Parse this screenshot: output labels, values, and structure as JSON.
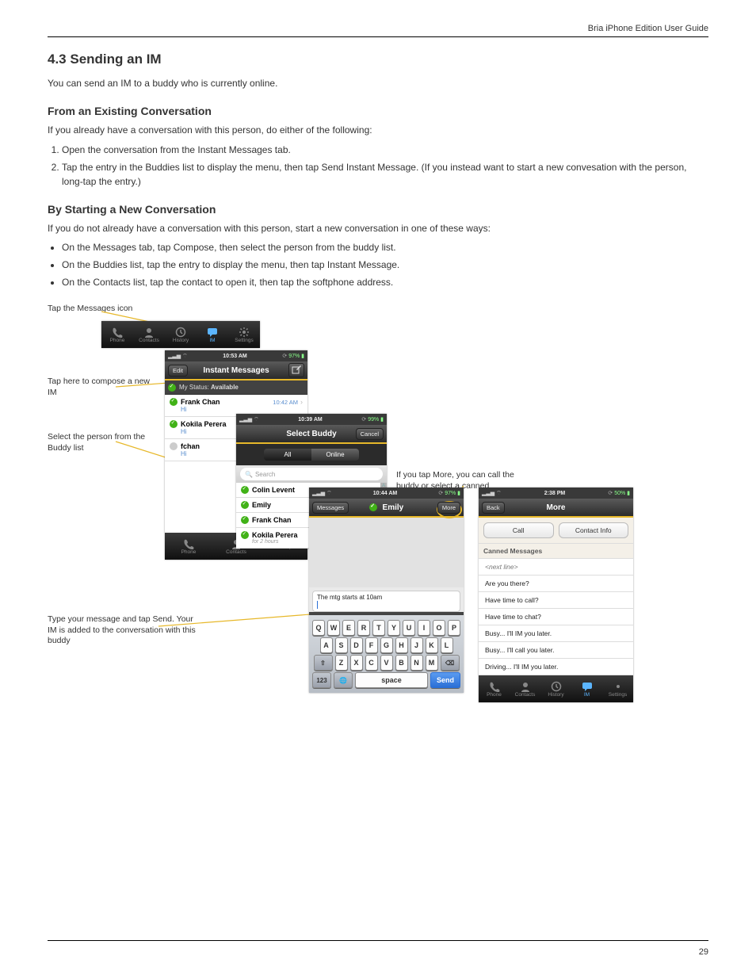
{
  "header": {
    "doc_title": "Bria iPhone Edition User Guide"
  },
  "footer": {
    "page": "29"
  },
  "section": {
    "heading": "4.3 Sending an IM",
    "para1": "You can send an IM to a buddy who is currently online.",
    "method1_title": "From an Existing Conversation",
    "method1_text": "If you already have a conversation with this person, do either of the following:",
    "steps": [
      "Open the conversation from the Instant Messages tab.",
      "Tap the entry in the Buddies list to display the menu, then tap Send Instant Message. (If you instead want to start a new convesation with the person, long-tap the entry.)"
    ],
    "method2_title": "By Starting a New Conversation",
    "method2_text": "If you do not already have a conversation with this person, start a new conversation in one of these ways:",
    "bullets": [
      "On the Messages tab, tap Compose, then select the person from the buddy list.",
      "On the Buddies list, tap the entry to display the menu, then tap Instant Message.",
      "On the Contacts list, tap the contact to open it, then tap the softphone address."
    ]
  },
  "callouts": {
    "c1": "Tap the Messages icon",
    "c2": "Tap here to compose a new IM",
    "c3": "Select the person from the Buddy list",
    "c4": "Type your message and tap Send. Your IM is added to the conversation with this buddy",
    "c5": "If you tap More, you can call the buddy or select a canned message"
  },
  "tabbar": {
    "items": [
      {
        "label": "Phone"
      },
      {
        "label": "Contacts"
      },
      {
        "label": "History"
      },
      {
        "label": "IM"
      },
      {
        "label": "Settings"
      }
    ]
  },
  "phoneA": {
    "time": "10:53 AM",
    "battery": "97%",
    "edit": "Edit",
    "title": "Instant Messages",
    "status_label": "My Status:",
    "status_value": "Available",
    "rows": [
      {
        "name": "Frank Chan",
        "msg": "Hi",
        "time": "10:42 AM",
        "dot": "green"
      },
      {
        "name": "Kokila Perera",
        "msg": "Hi",
        "time": "",
        "dot": "green"
      },
      {
        "name": "fchan",
        "msg": "Hi",
        "time": "",
        "dot": "gray"
      }
    ]
  },
  "phoneB": {
    "time": "10:39 AM",
    "battery": "99%",
    "title": "Select Buddy",
    "cancel": "Cancel",
    "seg_all": "All",
    "seg_online": "Online",
    "search": "Search",
    "rows": [
      {
        "name_bold": "Colin",
        "name": "Levent",
        "dot": "green"
      },
      {
        "name_bold": "Emily",
        "name": "",
        "dot": "green"
      },
      {
        "name_bold": "Frank",
        "name": "Chan",
        "dot": "green"
      },
      {
        "name_bold": "Kokila",
        "name": "Perera",
        "sub": "for 2 hours",
        "dot": "green"
      }
    ]
  },
  "phoneC": {
    "time": "10:44 AM",
    "battery": "97%",
    "messages": "Messages",
    "name": "Emily",
    "more": "More",
    "input": "The mtg starts at 10am",
    "keys_r1": [
      "Q",
      "W",
      "E",
      "R",
      "T",
      "Y",
      "U",
      "I",
      "O",
      "P"
    ],
    "keys_r2": [
      "A",
      "S",
      "D",
      "F",
      "G",
      "H",
      "J",
      "K",
      "L"
    ],
    "keys_r3": [
      "Z",
      "X",
      "C",
      "V",
      "B",
      "N",
      "M"
    ],
    "key_123": "123",
    "key_space": "space",
    "key_send": "Send"
  },
  "phoneD": {
    "time": "2:38 PM",
    "battery": "50%",
    "back": "Back",
    "title": "More",
    "call": "Call",
    "contact": "Contact Info",
    "section": "Canned Messages",
    "rows": [
      "<next line>",
      "Are you there?",
      "Have time to call?",
      "Have time to chat?",
      "Busy... I'll IM you later.",
      "Busy... I'll call you later.",
      "Driving... I'll IM you later."
    ]
  }
}
